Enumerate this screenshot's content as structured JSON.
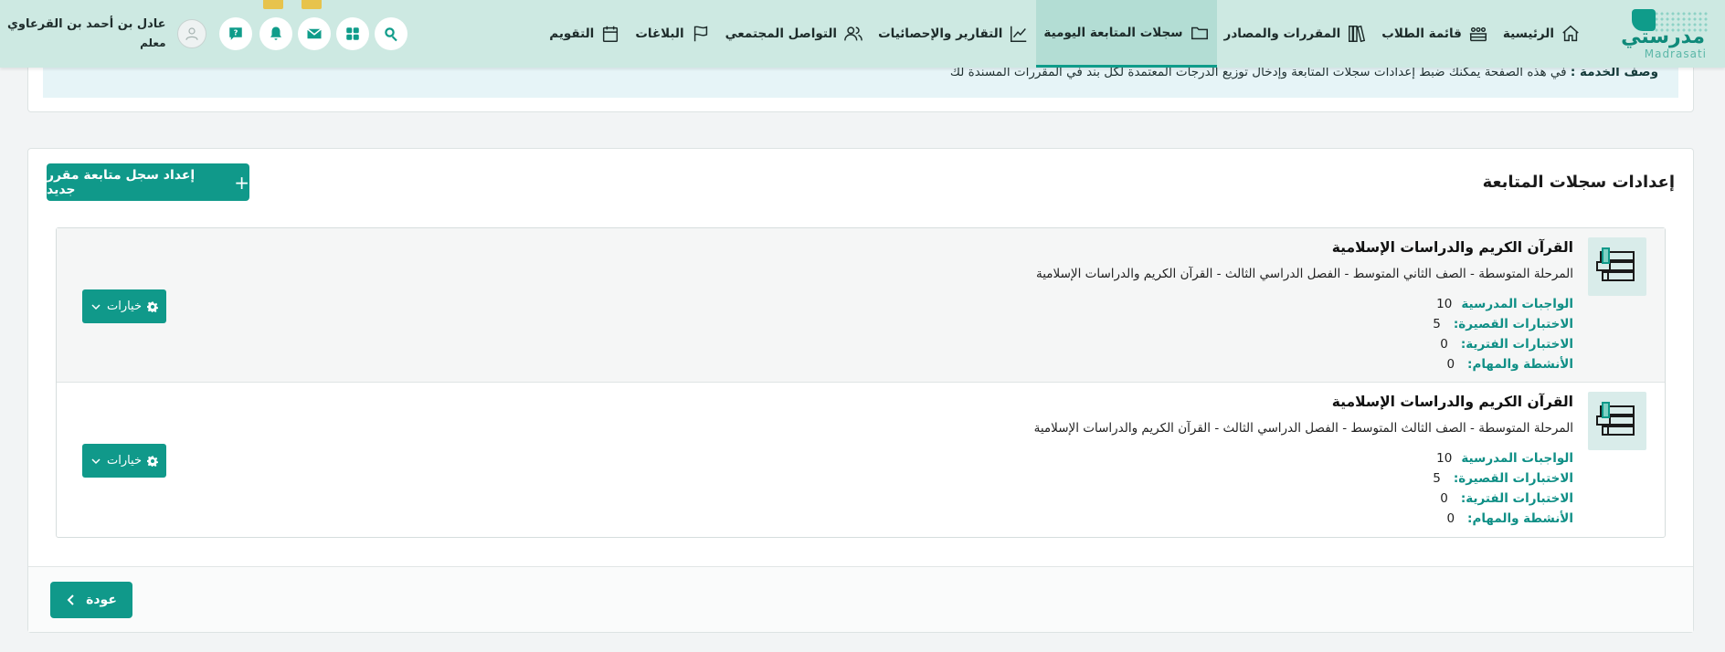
{
  "logo": {
    "arabic": "مدرستي",
    "english": "Madrasati"
  },
  "nav": [
    {
      "label": "الرئيسية",
      "icon": "home-icon"
    },
    {
      "label": "قائمة الطلاب",
      "icon": "students-icon"
    },
    {
      "label": "المقررات والمصادر",
      "icon": "books-icon"
    },
    {
      "label": "سجلات المتابعة اليومية",
      "icon": "folder-icon",
      "active": true
    },
    {
      "label": "التقارير والإحصائيات",
      "icon": "chart-line-icon"
    },
    {
      "label": "التواصل المجتمعي",
      "icon": "community-icon"
    },
    {
      "label": "البلاغات",
      "icon": "flag-icon"
    },
    {
      "label": "التقويم",
      "icon": "calendar-icon"
    }
  ],
  "user": {
    "name": "عادل بن أحمد بن القرعاوي",
    "role": "معلم"
  },
  "info": {
    "label": "وصف الخدمة :",
    "text": "في هذه الصفحة يمكنك ضبط إعدادات سجلات المتابعة وإدخال توزيع الدرجات المعتمدة لكل بند في المقررات المسندة لك"
  },
  "main": {
    "title": "إعدادات سجلات المتابعة",
    "add_button": "إعداد سجل متابعة مقرر جديد",
    "options_label": "خيارات",
    "back_label": "عودة"
  },
  "courses": [
    {
      "title": "القرآن الكريم والدراسات الإسلامية",
      "path": "المرحلة المتوسطة - الصف الثاني المتوسط - الفصل الدراسي الثالث - القرآن الكريم والدراسات الإسلامية",
      "stats": [
        {
          "label": "الواجبات المدرسية",
          "value": "10"
        },
        {
          "label": "الاختبارات القصيرة",
          "value": "5"
        },
        {
          "label": "الاختبارات الفترية",
          "value": "0"
        },
        {
          "label": "الأنشطة والمهام",
          "value": "0"
        }
      ]
    },
    {
      "title": "القرآن الكريم والدراسات الإسلامية",
      "path": "المرحلة المتوسطة - الصف الثالث المتوسط - الفصل الدراسي الثالث - القرآن الكريم والدراسات الإسلامية",
      "stats": [
        {
          "label": "الواجبات المدرسية",
          "value": "10"
        },
        {
          "label": "الاختبارات القصيرة",
          "value": "5"
        },
        {
          "label": "الاختبارات الفترية",
          "value": "0"
        },
        {
          "label": "الأنشطة والمهام",
          "value": "0"
        }
      ]
    }
  ],
  "colors": {
    "primary": "#10998a",
    "nav_bg": "#cde9e2",
    "badge": "#e7c34c"
  }
}
